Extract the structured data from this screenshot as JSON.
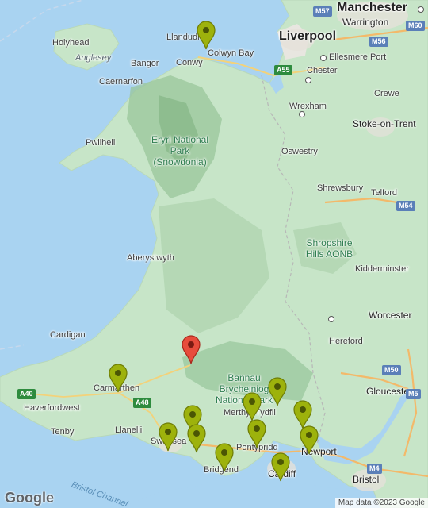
{
  "colors": {
    "sea": "#a9d3f1",
    "land": "#c7e5c8",
    "highland": "#9ac69b",
    "marker_green": "#9db20c",
    "marker_red": "#e74c3c"
  },
  "labels": {
    "manchester": "Manchester",
    "warrington": "Warrington",
    "liverpool": "Liverpool",
    "holyhead": "Holyhead",
    "llandudno": "Llandudno",
    "colwyn_bay": "Colwyn Bay",
    "conwy": "Conwy",
    "anglesey": "Anglesey",
    "bangor": "Bangor",
    "caernarfon": "Caernarfon",
    "ellesmere_port": "Ellesmere Port",
    "chester": "Chester",
    "crewe": "Crewe",
    "wrexham": "Wrexham",
    "stoke": "Stoke-on-Trent",
    "pwllheli": "Pwllheli",
    "eryri": "Eryri National Park (Snowdonia)",
    "oswestry": "Oswestry",
    "shrewsbury": "Shrewsbury",
    "telford": "Telford",
    "shropshire": "Shropshire Hills AONB",
    "aberystwyth": "Aberystwyth",
    "kidderminster": "Kidderminster",
    "worcester": "Worcester",
    "cardigan": "Cardigan",
    "hereford": "Hereford",
    "bannau": "Bannau Brycheiniog National Park",
    "carmarthen": "Carmarthen",
    "haverfordwest": "Haverfordwest",
    "gloucester": "Gloucester",
    "merthyr": "Merthyr Tydfil",
    "tenby": "Tenby",
    "llanelli": "Llanelli",
    "swansea": "Swansea",
    "pontypridd": "Pontypridd",
    "newport": "Newport",
    "bridgend": "Bridgend",
    "cardiff": "Cardiff",
    "bristol": "Bristol",
    "bristol_channel": "Bristol Channel"
  },
  "roads": {
    "m57": "M57",
    "m60": "M60",
    "m56": "M56",
    "a55": "A55",
    "m54": "M54",
    "m50": "M50",
    "a40": "A40",
    "a48": "A48",
    "m4": "M4",
    "m5": "M5"
  },
  "markers": [
    {
      "color": "green",
      "place": "Colwyn Bay"
    },
    {
      "color": "red",
      "place": "Mid Wales"
    },
    {
      "color": "green",
      "place": "Carmarthen"
    },
    {
      "color": "green",
      "place": "Merthyr Tydfil"
    },
    {
      "color": "green",
      "place": "Merthyr Tydfil south"
    },
    {
      "color": "green",
      "place": "Ebbw Vale"
    },
    {
      "color": "green",
      "place": "Neath"
    },
    {
      "color": "green",
      "place": "Swansea"
    },
    {
      "color": "green",
      "place": "Swansea east"
    },
    {
      "color": "green",
      "place": "Pontypridd"
    },
    {
      "color": "green",
      "place": "Newport"
    },
    {
      "color": "green",
      "place": "Bridgend"
    },
    {
      "color": "green",
      "place": "Cardiff"
    }
  ],
  "footer": {
    "logo": "Google",
    "attribution": "Map data ©2023 Google"
  }
}
